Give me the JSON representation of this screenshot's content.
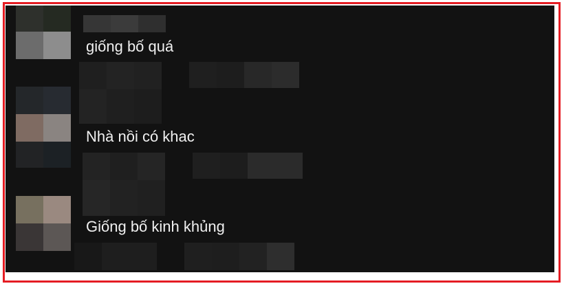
{
  "comments": [
    {
      "text": "giống bố quá"
    },
    {
      "text": "Nhà nồi có khac"
    },
    {
      "text": "Giống bố kinh khủng"
    }
  ],
  "colors": {
    "frame": "#e51c23",
    "panel": "#121212",
    "text": "#f0f0f0"
  }
}
